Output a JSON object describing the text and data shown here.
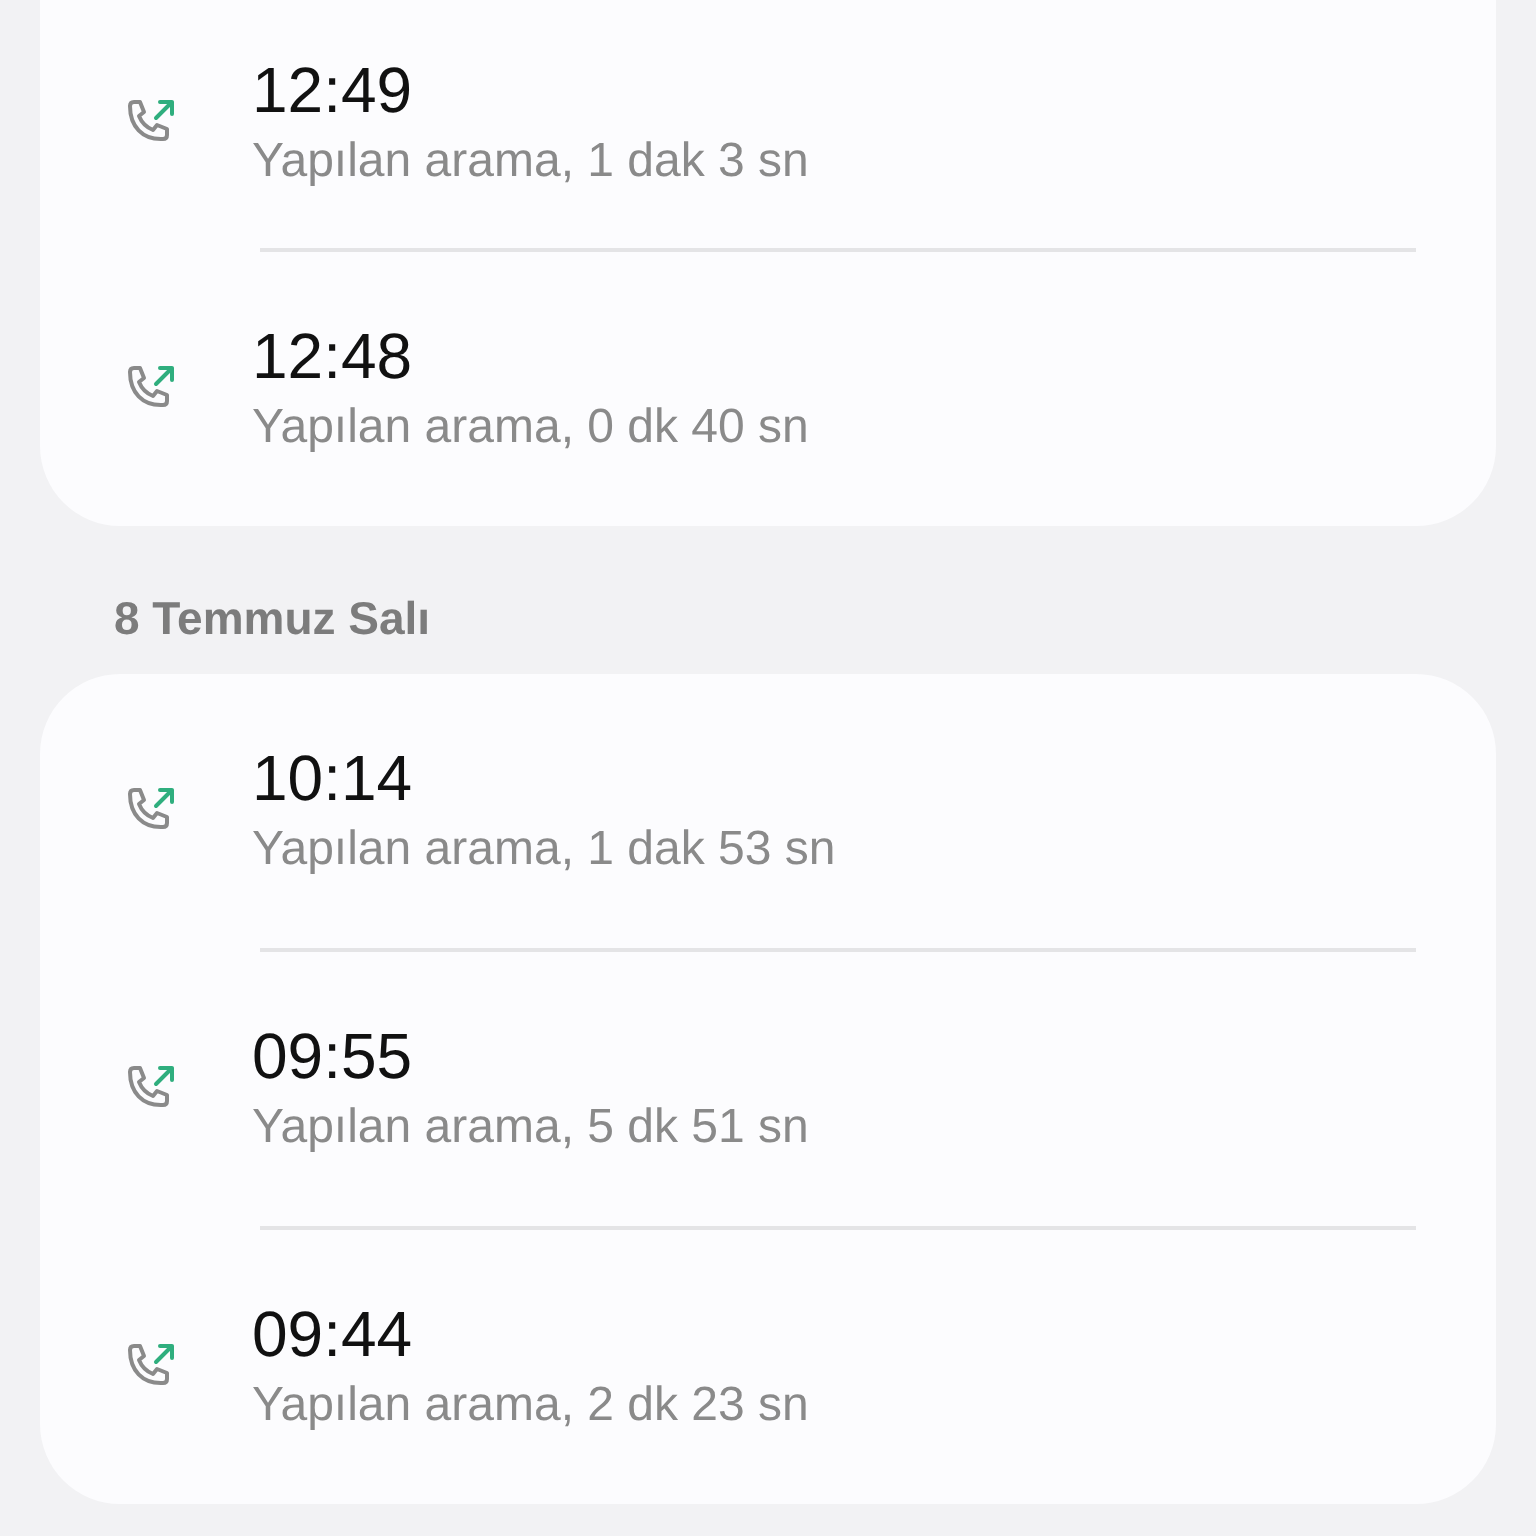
{
  "groups": [
    {
      "calls": [
        {
          "time": "12:49",
          "detail": "Yapılan arama, 1 dak 3 sn"
        },
        {
          "time": "12:48",
          "detail": "Yapılan arama, 0 dk 40 sn"
        }
      ]
    },
    {
      "header": "8 Temmuz Salı",
      "calls": [
        {
          "time": "10:14",
          "detail": "Yapılan arama, 1 dak 53 sn"
        },
        {
          "time": "09:55",
          "detail": "Yapılan arama, 5 dk 51 sn"
        },
        {
          "time": "09:44",
          "detail": "Yapılan arama, 2 dk 23 sn"
        }
      ]
    }
  ]
}
